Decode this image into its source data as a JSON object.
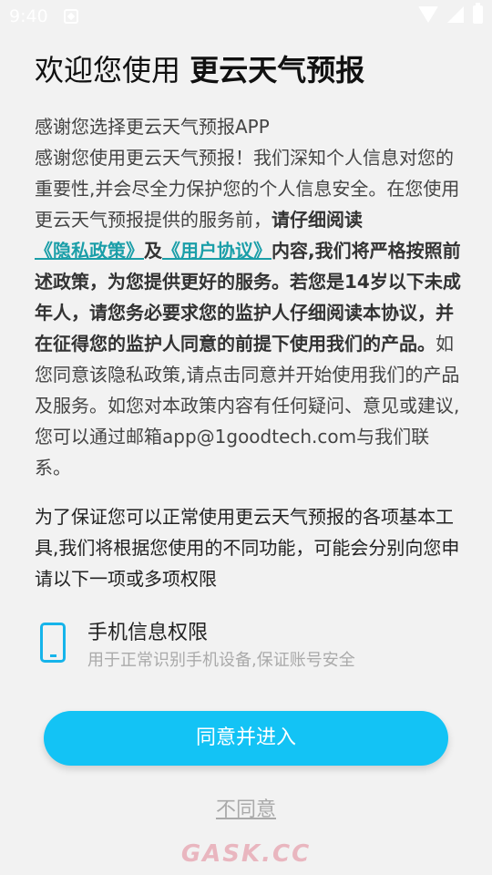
{
  "status_bar": {
    "time": "9:40"
  },
  "title": {
    "prefix": "欢迎您使用 ",
    "app_name": "更云天气预报"
  },
  "body": {
    "p1": "感谢您选择更云天气预报APP",
    "p2": "感谢您使用更云天气预报！我们深知个人信息对您的重要性,并会尽全力保护您的个人信息安全。在您使用更云天气预报提供的服务前，",
    "p2_bold": "请仔细阅读",
    "privacy_link": "《隐私政策》",
    "and": "及",
    "agreement_link": "《用户协议》",
    "p3_bold": "内容,我们将严格按照前述政策，为您提供更好的服务。若您是14岁以下未成年人，请您务必要求您的监护人仔细阅读本协议，并在征得您的监护人同意的前提下使用我们的产品。",
    "p4": "如您同意该隐私政策,请点击同意并开始使用我们的产品及服务。如您对本政策内容有任何疑问、意见或建议,您可以通过邮箱app@1goodtech.com与我们联系。"
  },
  "permissions": {
    "intro": "为了保证您可以正常使用更云天气预报的各项基本工具,我们将根据您使用的不同功能，可能会分别向您申请以下一项或多项权限",
    "items": [
      {
        "icon": "phone-icon",
        "title": "手机信息权限",
        "desc": "用于正常识别手机设备,保证账号安全"
      }
    ]
  },
  "buttons": {
    "agree": "同意并进入",
    "disagree": "不同意"
  },
  "watermark": "GASK.CC",
  "colors": {
    "accent": "#13c3f5",
    "link": "#1a9ea8",
    "background": "#f2f2f2"
  }
}
